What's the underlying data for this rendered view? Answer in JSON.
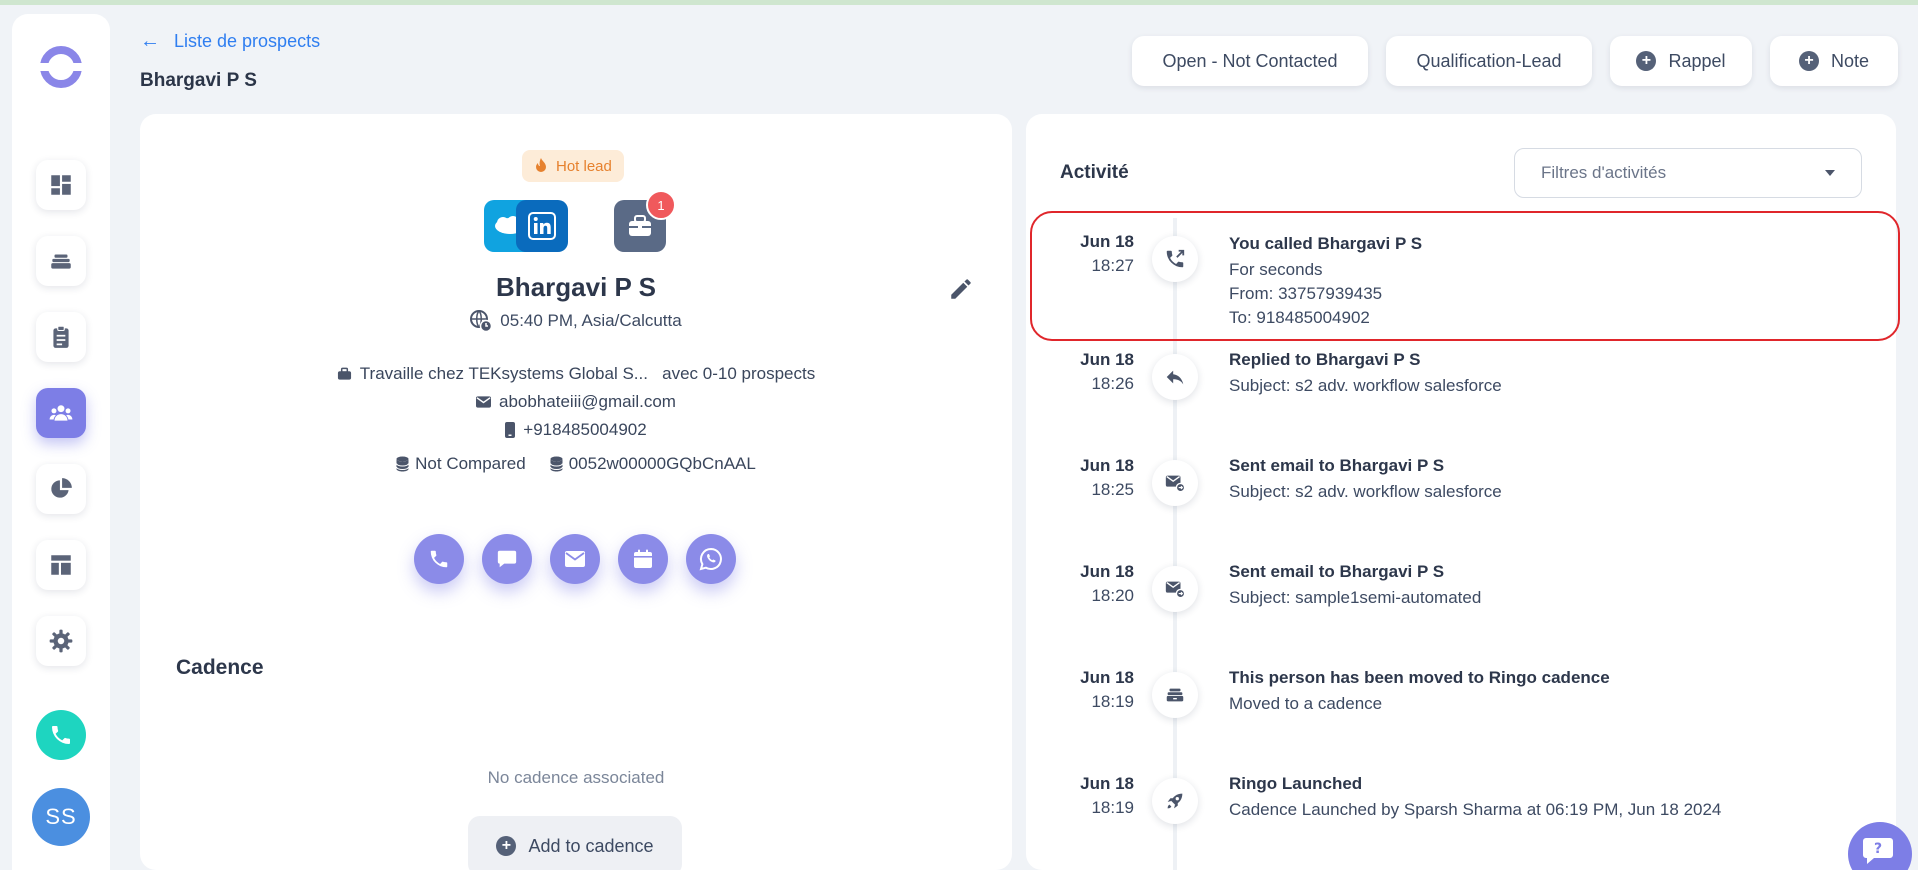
{
  "colors": {
    "accent": "#7d7ee6",
    "link": "#2f7ef0",
    "highlight": "#e0262b",
    "teal": "#1ed5c0",
    "hot": "#e6812e"
  },
  "sidebar": {
    "items": [
      {
        "name": "dashboard-icon"
      },
      {
        "name": "stack-icon"
      },
      {
        "name": "clipboard-icon"
      },
      {
        "name": "people-icon",
        "active": true
      },
      {
        "name": "pie-chart-icon"
      },
      {
        "name": "layout-icon"
      },
      {
        "name": "gear-icon"
      }
    ],
    "avatar": "SS"
  },
  "header": {
    "back_label": "Liste de prospects",
    "title": "Bhargavi P S",
    "buttons": {
      "status": "Open - Not Contacted",
      "stage": "Qualification-Lead",
      "rappel": "Rappel",
      "note": "Note"
    }
  },
  "prospect": {
    "badge": "Hot lead",
    "notification_count": "1",
    "name": "Bhargavi P S",
    "timezone": "05:40 PM, Asia/Calcutta",
    "company": "Travaille chez TEKsystems Global S...   avec 0-10 prospects",
    "email": "abobhateiii@gmail.com",
    "phone": "+918485004902",
    "crm_status": "Not Compared",
    "crm_id": "0052w00000GQbCnAAL"
  },
  "cadence": {
    "title": "Cadence",
    "empty": "No cadence associated",
    "add_label": "Add to cadence"
  },
  "activity": {
    "title": "Activité",
    "filter_placeholder": "Filtres d'activités",
    "items": [
      {
        "date": "Jun 18",
        "time": "18:27",
        "icon": "outgoing-call-icon",
        "title": "You called Bhargavi P S",
        "lines": [
          "For seconds",
          "From: 33757939435",
          "To: 918485004902"
        ]
      },
      {
        "date": "Jun 18",
        "time": "18:26",
        "icon": "reply-icon",
        "title": "Replied to Bhargavi P S",
        "lines": [
          "Subject: s2 adv. workflow salesforce"
        ]
      },
      {
        "date": "Jun 18",
        "time": "18:25",
        "icon": "sent-email-icon",
        "title": "Sent email to Bhargavi P S",
        "lines": [
          "Subject: s2 adv. workflow salesforce"
        ]
      },
      {
        "date": "Jun 18",
        "time": "18:20",
        "icon": "sent-email-icon",
        "title": "Sent email to Bhargavi P S",
        "lines": [
          "Subject: sample1semi-automated"
        ]
      },
      {
        "date": "Jun 18",
        "time": "18:19",
        "icon": "cadence-move-icon",
        "title": "This person has been moved to Ringo cadence",
        "lines": [
          "Moved to a cadence"
        ]
      },
      {
        "date": "Jun 18",
        "time": "18:19",
        "icon": "rocket-icon",
        "title": "Ringo Launched",
        "lines": [
          "Cadence Launched by Sparsh Sharma at 06:19 PM, Jun 18 2024"
        ]
      }
    ]
  }
}
